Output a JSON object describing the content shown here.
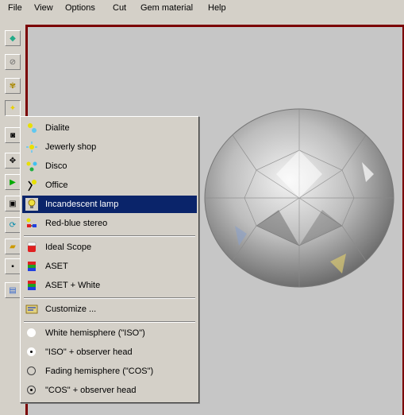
{
  "menubar": {
    "items": [
      "File",
      "View",
      "Options",
      "Cut",
      "Gem material",
      "Help"
    ]
  },
  "toolbar": {
    "icons": [
      "gem-light-icon",
      "lens-icon",
      "gem-settings-icon",
      "light-icon",
      "camera-icon",
      "move-icon",
      "play-icon",
      "diamond-view-icon",
      "rotate-icon",
      "open-folder-icon",
      "save-icon",
      "window-icon"
    ]
  },
  "lighting_menu": {
    "items": [
      {
        "label": "Dialite",
        "icon": "dialite-lamp-icon"
      },
      {
        "label": "Jewerly shop",
        "icon": "shop-lamp-icon"
      },
      {
        "label": "Disco",
        "icon": "disco-lights-icon"
      },
      {
        "label": "Office",
        "icon": "office-lamp-icon"
      },
      {
        "label": "Incandescent lamp",
        "icon": "bulb-icon",
        "selected": true
      },
      {
        "label": "Red-blue stereo",
        "icon": "stereo-glasses-icon"
      }
    ],
    "scope_items": [
      {
        "label": "Ideal Scope",
        "icon": "ideal-scope-icon"
      },
      {
        "label": "ASET",
        "icon": "aset-icon"
      },
      {
        "label": "ASET + White",
        "icon": "aset-white-icon"
      }
    ],
    "customize_label": "Customize ...",
    "hemisphere_items": [
      {
        "label": "White hemisphere (\"ISO\")",
        "state": "white"
      },
      {
        "label": "\"ISO\" + observer head",
        "state": "dot"
      },
      {
        "label": "Fading hemisphere (\"COS\")",
        "state": "empty"
      },
      {
        "label": "\"COS\" + observer head",
        "state": "ring-dot"
      }
    ]
  },
  "colors": {
    "highlight": "#0a246a",
    "viewport_border": "#7b0000",
    "viewport_bg": "#c6c6c6"
  }
}
